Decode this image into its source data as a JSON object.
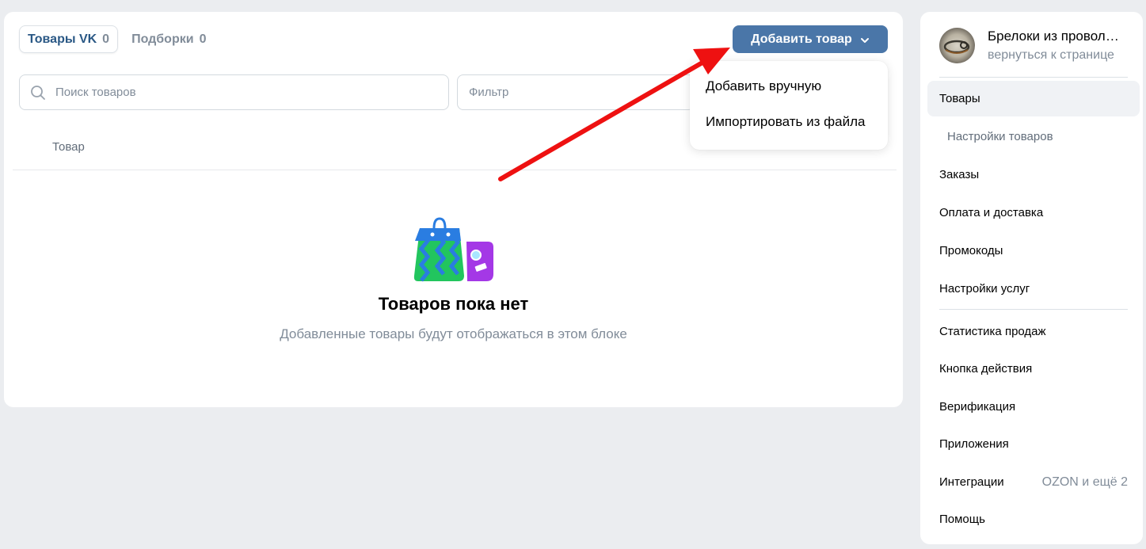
{
  "tabs": [
    {
      "label": "Товары VK",
      "count": "0"
    },
    {
      "label": "Подборки",
      "count": "0"
    }
  ],
  "add_button": {
    "label": "Добавить товар",
    "icon": "chevron-down-icon"
  },
  "search": {
    "placeholder": "Поиск товаров",
    "icon": "search-icon"
  },
  "filter": {
    "placeholder": "Фильтр"
  },
  "table": {
    "column_header": "Товар"
  },
  "empty_state": {
    "title": "Товаров пока нет",
    "subtitle": "Добавленные товары будут отображаться в этом блоке"
  },
  "dropdown": {
    "items": [
      "Добавить вручную",
      "Импортировать из файла"
    ]
  },
  "sidebar": {
    "group_name": "Брелоки из проволоки",
    "group_back": "вернуться к странице",
    "menu": [
      {
        "label": "Товары",
        "active": true
      },
      {
        "label": "Настройки товаров",
        "sub": true
      },
      {
        "label": "Заказы"
      },
      {
        "label": "Оплата и доставка"
      },
      {
        "label": "Промокоды"
      },
      {
        "label": "Настройки услуг"
      }
    ],
    "menu2": [
      {
        "label": "Статистика продаж"
      },
      {
        "label": "Кнопка действия"
      },
      {
        "label": "Верификация"
      },
      {
        "label": "Приложения"
      },
      {
        "label": "Интеграции",
        "extra": "OZON и ещё 2"
      },
      {
        "label": "Помощь"
      }
    ]
  },
  "colors": {
    "accent": "#4a76a8",
    "background": "#ebedf0",
    "annotation_arrow": "#ee1111"
  }
}
